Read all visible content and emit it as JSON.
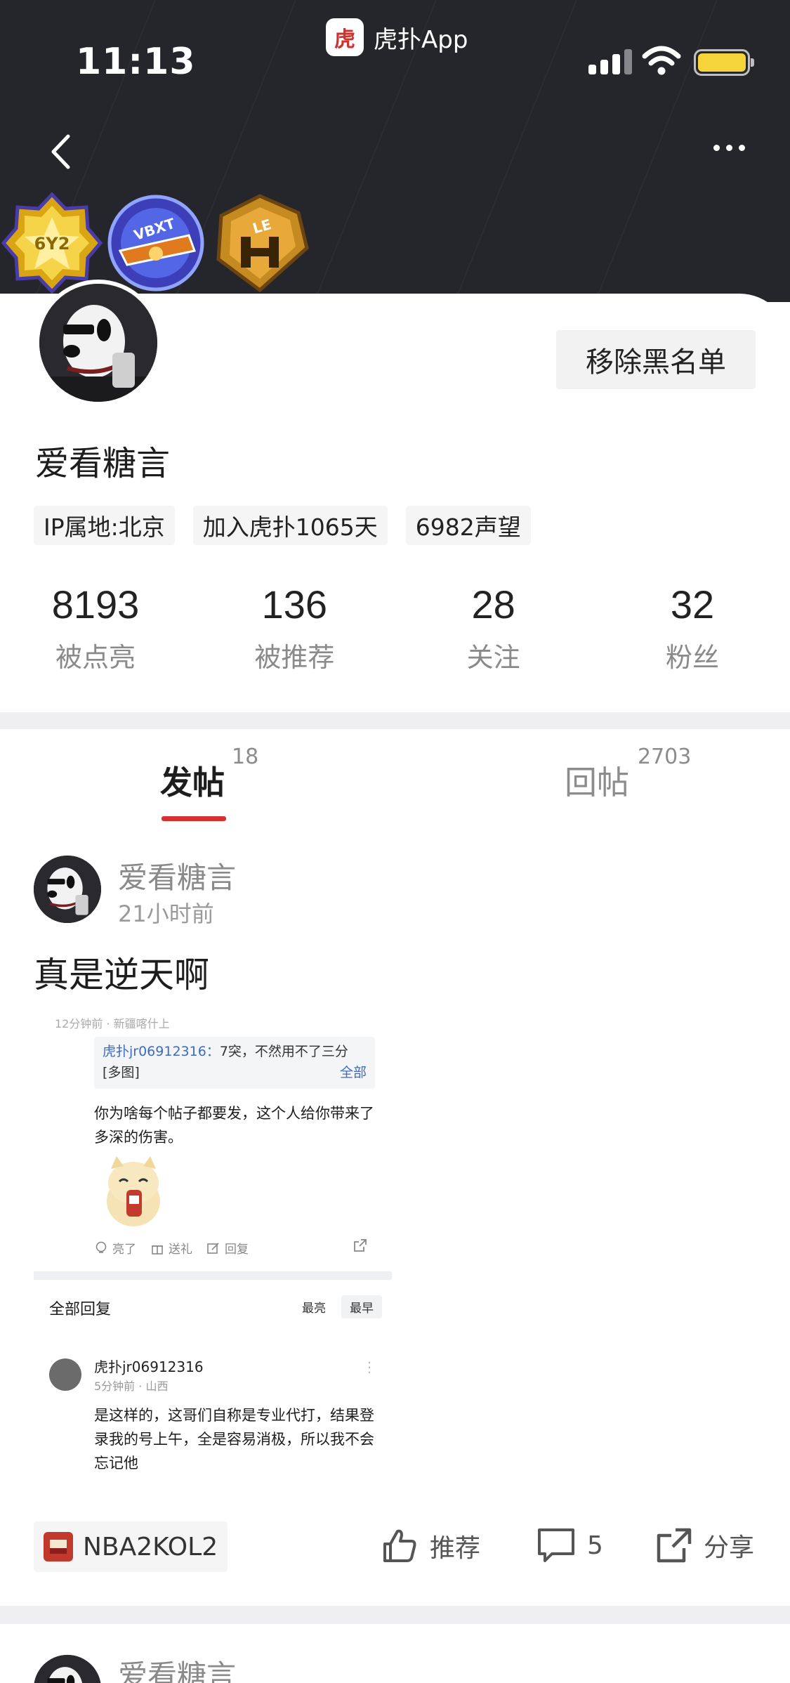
{
  "status_bar": {
    "time": "11:13",
    "app_name": "虎扑App",
    "app_logo_text": "虎扑"
  },
  "header": {
    "back_icon": "chevron-left-icon",
    "more_icon": "more-dots-icon",
    "badges": [
      "gold-medal-badge",
      "blue-medal-badge",
      "gold-shield-badge"
    ]
  },
  "profile": {
    "remove_blacklist_label": "移除黑名单",
    "username": "爱看糖言",
    "chips": [
      "IP属地:北京",
      "加入虎扑1065天",
      "6982声望"
    ],
    "stats": [
      {
        "value": "8193",
        "label": "被点亮"
      },
      {
        "value": "136",
        "label": "被推荐"
      },
      {
        "value": "28",
        "label": "关注"
      },
      {
        "value": "32",
        "label": "粉丝"
      }
    ]
  },
  "tabs": [
    {
      "label": "发帖",
      "count": "18",
      "active": true
    },
    {
      "label": "回帖",
      "count": "2703",
      "active": false
    }
  ],
  "post": {
    "author": "爱看糖言",
    "time": "21小时前",
    "title": "真是逆天啊",
    "image": {
      "cut_text": "12分钟前 · 新疆喀什上",
      "quote_user": "虎扑jr06912316：",
      "quote_text": "7突，不然用不了三分",
      "quote_tag": "[多图]",
      "quote_all": "全部",
      "reply_text": "你为啥每个帖子都要发，这个人给你带来了多深的伤害。",
      "actions": [
        "亮了",
        "送礼",
        "回复"
      ],
      "all_replies": "全部回复",
      "sort": [
        "最亮",
        "最早"
      ],
      "reply_user": "虎扑jr06912316",
      "reply_meta": "5分钟前 · 山西",
      "reply_body": "是这样的，这哥们自称是专业代打，结果登录我的号上午，全是容易消极，所以我不会忘记他"
    },
    "forum": "NBA2KOL2",
    "recommend_label": "推荐",
    "comment_count": "5",
    "share_label": "分享"
  },
  "next_post": {
    "author": "爱看糖言"
  },
  "colors": {
    "header_bg": "#24262b",
    "accent_red": "#d63031",
    "battery": "#f5d33b",
    "link_blue": "#3b6bc4"
  }
}
